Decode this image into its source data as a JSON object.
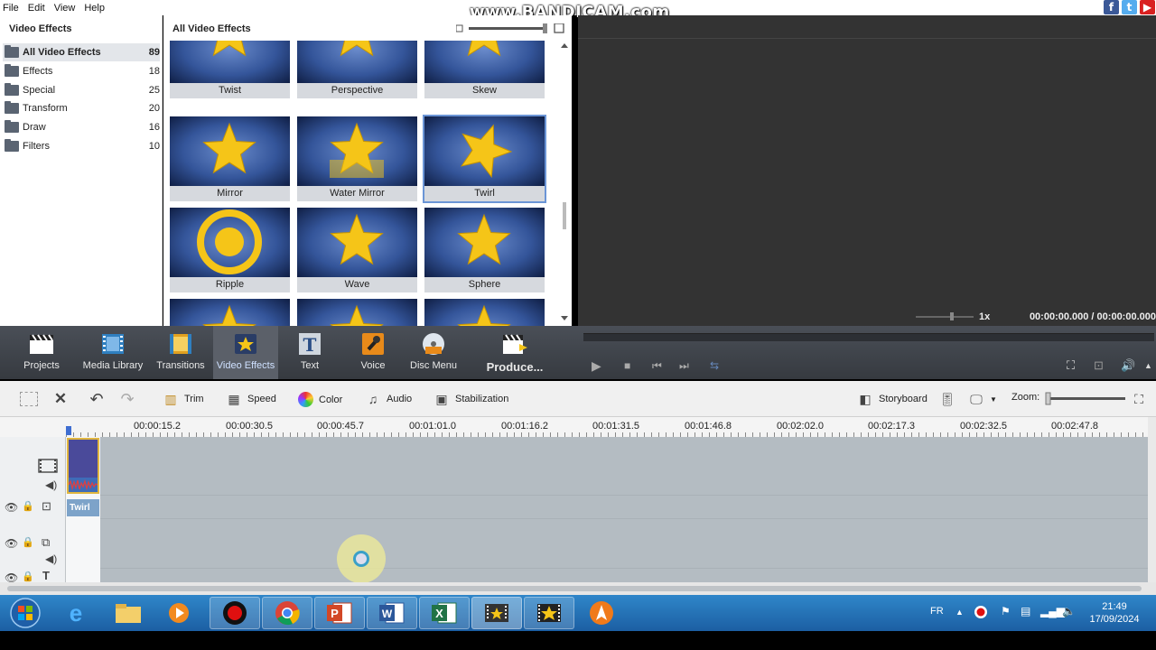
{
  "menu": [
    "File",
    "Edit",
    "View",
    "Help"
  ],
  "watermark": "www.BANDICAM.com",
  "categories_panel": {
    "title": "Video Effects",
    "items": [
      {
        "label": "All Video Effects",
        "count": "89",
        "selected": true
      },
      {
        "label": "Effects",
        "count": "18"
      },
      {
        "label": "Special",
        "count": "25"
      },
      {
        "label": "Transform",
        "count": "20"
      },
      {
        "label": "Draw",
        "count": "16"
      },
      {
        "label": "Filters",
        "count": "10"
      }
    ]
  },
  "effects_panel": {
    "title": "All Video Effects",
    "tiles": [
      {
        "label": "Twist"
      },
      {
        "label": "Perspective"
      },
      {
        "label": "Skew"
      },
      {
        "label": "Mirror"
      },
      {
        "label": "Water Mirror"
      },
      {
        "label": "Twirl",
        "selected": true
      },
      {
        "label": "Ripple"
      },
      {
        "label": "Wave"
      },
      {
        "label": "Sphere"
      },
      {
        "label": ""
      },
      {
        "label": ""
      },
      {
        "label": ""
      }
    ]
  },
  "preview": {
    "speed": "1x",
    "time": "00:00:00.000 / 00:00:00.000"
  },
  "toolbar": {
    "projects": "Projects",
    "media_library": "Media Library",
    "transitions": "Transitions",
    "video_effects": "Video Effects",
    "text": "Text",
    "voice": "Voice",
    "disc_menu": "Disc Menu",
    "produce": "Produce..."
  },
  "edit_bar": {
    "trim": "Trim",
    "speed": "Speed",
    "color": "Color",
    "audio": "Audio",
    "stabilization": "Stabilization",
    "storyboard": "Storyboard",
    "zoom": "Zoom:"
  },
  "ruler": [
    "00:00:15.2",
    "00:00:30.5",
    "00:00:45.7",
    "00:01:01.0",
    "00:01:16.2",
    "00:01:31.5",
    "00:01:46.8",
    "00:02:02.0",
    "00:02:17.3",
    "00:02:32.5",
    "00:02:47.8"
  ],
  "timeline": {
    "effect_clip": "Twirl"
  },
  "taskbar": {
    "lang": "FR",
    "time": "21:49",
    "date": "17/09/2024"
  },
  "colors": {
    "accent": "#6b95d6",
    "star": "#f5c518",
    "toolbar_bg": "#3f434a",
    "timeline_bg": "#b4bcc2"
  }
}
